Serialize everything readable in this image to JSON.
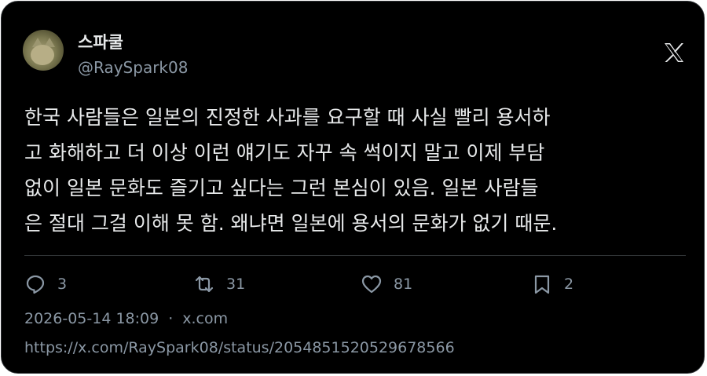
{
  "author": {
    "name": "스파쿨",
    "handle": "@RaySpark08",
    "avatar_icon": "cat-avatar"
  },
  "platform": {
    "logo_icon": "x-logo-icon",
    "logo_text": "𝕏"
  },
  "tweet": {
    "text": "한국 사람들은 일본의 진정한 사과를 요구할 때 사실 빨리 용서하\n고 화해하고 더 이상 이런 얘기도 자꾸 속 썩이지 말고 이제 부담\n없이 일본 문화도 즐기고 싶다는 그런 본심이 있음. 일본 사람들\n은 절대 그걸 이해 못 함. 왜냐면 일본에 용서의 문화가 없기 때문."
  },
  "actions": {
    "replies": "3",
    "retweets": "31",
    "likes": "81",
    "bookmarks": "2"
  },
  "meta": {
    "timestamp": "2026-05-14 18:09",
    "separator": "·",
    "source": "x.com",
    "url": "https://x.com/RaySpark08/status/2054851520529678566"
  },
  "colors": {
    "background": "#000000",
    "text": "#e7e9ea",
    "muted": "#8b98a5",
    "border": "#2f3336"
  }
}
